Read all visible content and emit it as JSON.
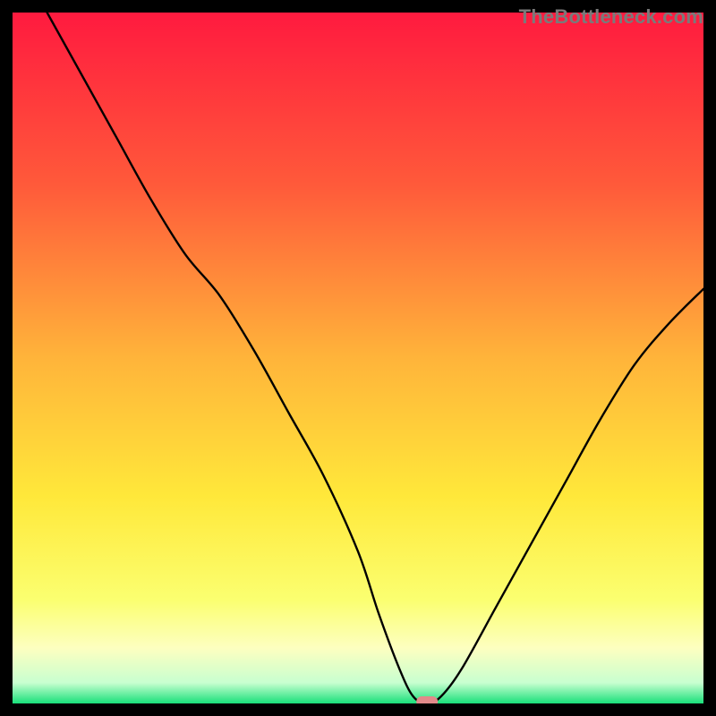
{
  "watermark": "TheBottleneck.com",
  "chart_data": {
    "type": "line",
    "title": "",
    "xlabel": "",
    "ylabel": "",
    "xlim": [
      0,
      100
    ],
    "ylim": [
      0,
      100
    ],
    "grid": false,
    "legend": false,
    "series": [
      {
        "name": "bottleneck-curve",
        "x": [
          5,
          10,
          15,
          20,
          25,
          30,
          35,
          40,
          45,
          50,
          53,
          56,
          58,
          60,
          62,
          65,
          70,
          75,
          80,
          85,
          90,
          95,
          100
        ],
        "y": [
          100,
          91,
          82,
          73,
          65,
          59,
          51,
          42,
          33,
          22,
          13,
          5,
          1,
          0,
          1,
          5,
          14,
          23,
          32,
          41,
          49,
          55,
          60
        ]
      }
    ],
    "marker": {
      "x": 60,
      "y": 0,
      "color": "#e18a8a"
    },
    "background_gradient": {
      "stops": [
        {
          "offset": 0.0,
          "color": "#ff1a3f"
        },
        {
          "offset": 0.25,
          "color": "#ff5a3a"
        },
        {
          "offset": 0.5,
          "color": "#ffb43a"
        },
        {
          "offset": 0.7,
          "color": "#ffe83a"
        },
        {
          "offset": 0.85,
          "color": "#fbff70"
        },
        {
          "offset": 0.92,
          "color": "#fdffc0"
        },
        {
          "offset": 0.97,
          "color": "#c8ffd0"
        },
        {
          "offset": 1.0,
          "color": "#18e07a"
        }
      ]
    }
  }
}
